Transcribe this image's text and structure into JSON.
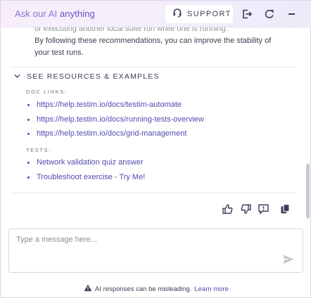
{
  "header": {
    "title_prefix": "Ask our AI",
    "title_highlight": "anything",
    "support_label": "SUPPORT",
    "icons": [
      "headset-icon",
      "exit-icon",
      "refresh-icon",
      "minimize-icon"
    ]
  },
  "content": {
    "truncated_line": "or executing another local suite run while one is running.",
    "closing_line_1": "By following these recommendations, you can improve the stability of",
    "closing_line_2": "your test runs.",
    "resources": {
      "heading": "SEE RESOURCES & EXAMPLES",
      "doc_links_label": "DOC LINKS:",
      "doc_links": [
        "https://help.testim.io/docs/testim-automate",
        "https://help.testim.io/docs/running-tests-overview",
        "https://help.testim.io/docs/grid-management"
      ],
      "tests_label": "TESTS:",
      "tests": [
        "Network validation quiz answer",
        "Troubleshoot exercise - Try Me!"
      ]
    }
  },
  "actions": {
    "icons": [
      "thumbs-up-icon",
      "thumbs-down-icon",
      "feedback-icon",
      "copy-icon"
    ]
  },
  "composer": {
    "placeholder": "Type a message here...",
    "value": ""
  },
  "footer": {
    "notice": "AI responses can be misleading.",
    "learn_more": "Learn more"
  },
  "colors": {
    "accent": "#6a4fc8",
    "link": "#4f4bb0",
    "text": "#3d3d52"
  }
}
